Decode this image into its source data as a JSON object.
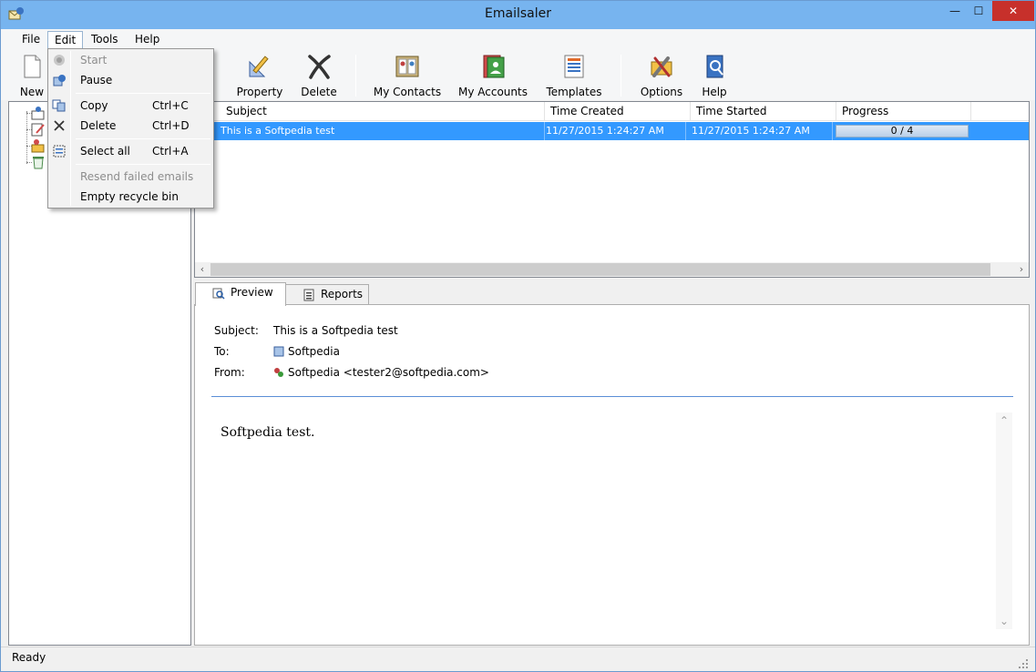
{
  "window": {
    "title": "Emailsaler"
  },
  "menubar": {
    "items": [
      "File",
      "Edit",
      "Tools",
      "Help"
    ]
  },
  "toolbar": {
    "new_label": "New",
    "property_label": "Property",
    "delete_label": "Delete",
    "contacts_label": "My Contacts",
    "accounts_label": "My Accounts",
    "templates_label": "Templates",
    "options_label": "Options",
    "help_label": "Help"
  },
  "list": {
    "columns": [
      "Subject",
      "Time Created",
      "Time Started",
      "Progress"
    ],
    "rows": [
      {
        "subject": "This is a Softpedia test",
        "time_created": "11/27/2015 1:24:27 AM",
        "time_started": "11/27/2015 1:24:27 AM",
        "progress_text": "0 / 4",
        "progress_fraction": 0.0
      }
    ]
  },
  "preview": {
    "tabs": [
      "Preview",
      "Reports"
    ],
    "subject_label": "Subject:",
    "subject_value": "This is a Softpedia test",
    "to_label": "To:",
    "to_value": "Softpedia",
    "from_label": "From:",
    "from_value": "Softpedia <tester2@softpedia.com>",
    "body": "Softpedia test."
  },
  "status": {
    "text": "Ready"
  },
  "edit_menu": {
    "start": "Start",
    "pause": "Pause",
    "copy": "Copy",
    "copy_shortcut": "Ctrl+C",
    "delete": "Delete",
    "delete_shortcut": "Ctrl+D",
    "select_all": "Select all",
    "select_all_shortcut": "Ctrl+A",
    "resend_failed": "Resend failed emails",
    "empty_recycle": "Empty recycle bin"
  },
  "colors": {
    "titlebar": "#77b4ef",
    "selection": "#3399ff",
    "close": "#c7302b",
    "divider": "#5b8ed6"
  }
}
